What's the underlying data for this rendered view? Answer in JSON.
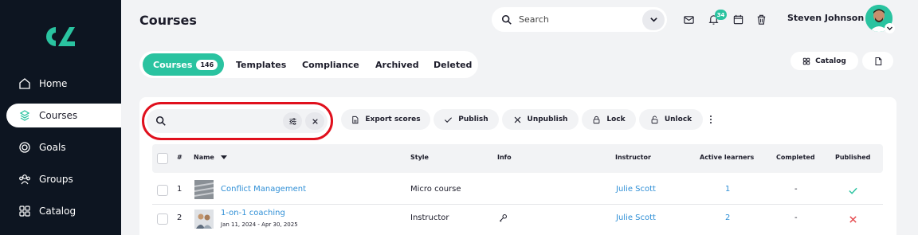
{
  "sidebar": {
    "items": [
      {
        "label": "Home",
        "icon": "home-icon"
      },
      {
        "label": "Courses",
        "icon": "courses-icon",
        "active": true
      },
      {
        "label": "Goals",
        "icon": "goals-icon"
      },
      {
        "label": "Groups",
        "icon": "groups-icon"
      },
      {
        "label": "Catalog",
        "icon": "catalog-icon"
      }
    ]
  },
  "header": {
    "title": "Courses",
    "search_placeholder": "Search",
    "notification_count": "34",
    "user_name": "Steven Johnson"
  },
  "tabs": [
    {
      "label": "Courses",
      "count": "146",
      "active": true
    },
    {
      "label": "Templates"
    },
    {
      "label": "Compliance"
    },
    {
      "label": "Archived"
    },
    {
      "label": "Deleted"
    }
  ],
  "right_actions": {
    "catalog_label": "Catalog"
  },
  "toolbar": {
    "export_label": "Export scores",
    "publish_label": "Publish",
    "unpublish_label": "Unpublish",
    "lock_label": "Lock",
    "unlock_label": "Unlock"
  },
  "table": {
    "columns": [
      "#",
      "Name",
      "Style",
      "Info",
      "Instructor",
      "Active learners",
      "Completed",
      "Published"
    ],
    "rows": [
      {
        "num": "1",
        "name": "Conflict Management",
        "dates": "",
        "style": "Micro course",
        "instructor": "Julie Scott",
        "active": "1",
        "completed": "-",
        "published": true
      },
      {
        "num": "2",
        "name": "1-on-1 coaching",
        "dates": "Jan 11, 2024 - Apr 30, 2025",
        "style": "Instructor",
        "instructor": "Julie Scott",
        "active": "2",
        "completed": "-",
        "published": false
      }
    ]
  },
  "colors": {
    "accent": "#2ac3a0",
    "sidebar": "#0d1521",
    "link": "#2f8fd6",
    "highlight": "#e0101d",
    "danger": "#e5484d"
  }
}
